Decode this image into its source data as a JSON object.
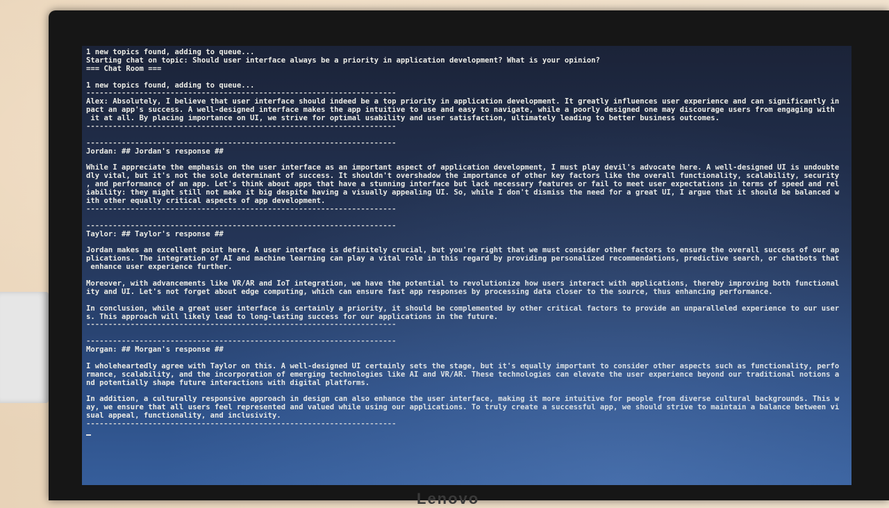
{
  "terminal": {
    "lines": [
      "1 new topics found, adding to queue...",
      "Starting chat on topic: Should user interface always be a priority in application development? What is your opinion?",
      "=== Chat Room ===",
      "",
      "1 new topics found, adding to queue...",
      "----------------------------------------------------------------------",
      "Alex: Absolutely, I believe that user interface should indeed be a top priority in application development. It greatly influences user experience and can significantly in",
      "pact an app's success. A well-designed interface makes the app intuitive to use and easy to navigate, while a poorly designed one may discourage users from engaging with",
      " it at all. By placing importance on UI, we strive for optimal usability and user satisfaction, ultimately leading to better business outcomes.",
      "----------------------------------------------------------------------",
      "",
      "----------------------------------------------------------------------",
      "Jordan: ## Jordan's response ##",
      "",
      "While I appreciate the emphasis on the user interface as an important aspect of application development, I must play devil's advocate here. A well-designed UI is undoubte",
      "dly vital, but it's not the sole determinant of success. It shouldn't overshadow the importance of other key factors like the overall functionality, scalability, security",
      ", and performance of an app. Let's think about apps that have a stunning interface but lack necessary features or fail to meet user expectations in terms of speed and rel",
      "iability: they might still not make it big despite having a visually appealing UI. So, while I don't dismiss the need for a great UI, I argue that it should be balanced w",
      "ith other equally critical aspects of app development.",
      "----------------------------------------------------------------------",
      "",
      "----------------------------------------------------------------------",
      "Taylor: ## Taylor's response ##",
      "",
      "Jordan makes an excellent point here. A user interface is definitely crucial, but you're right that we must consider other factors to ensure the overall success of our ap",
      "plications. The integration of AI and machine learning can play a vital role in this regard by providing personalized recommendations, predictive search, or chatbots that",
      " enhance user experience further.",
      "",
      "Moreover, with advancements like VR/AR and IoT integration, we have the potential to revolutionize how users interact with applications, thereby improving both functional",
      "ity and UI. Let's not forget about edge computing, which can ensure fast app responses by processing data closer to the source, thus enhancing performance.",
      "",
      "In conclusion, while a great user interface is certainly a priority, it should be complemented by other critical factors to provide an unparalleled experience to our user",
      "s. This approach will likely lead to long-lasting success for our applications in the future.",
      "----------------------------------------------------------------------",
      "",
      "----------------------------------------------------------------------",
      "Morgan: ## Morgan's response ##",
      "",
      "I wholeheartedly agree with Taylor on this. A well-designed UI certainly sets the stage, but it's equally important to consider other aspects such as functionality, perfo",
      "rmance, scalability, and the incorporation of emerging technologies like AI and VR/AR. These technologies can elevate the user experience beyond our traditional notions a",
      "nd potentially shape future interactions with digital platforms.",
      "",
      "In addition, a culturally responsive approach in design can also enhance the user interface, making it more intuitive for people from diverse cultural backgrounds. This w",
      "ay, we ensure that all users feel represented and valued while using our applications. To truly create a successful app, we should strive to maintain a balance between vi",
      "sual appeal, functionality, and inclusivity.",
      "----------------------------------------------------------------------"
    ]
  },
  "monitor": {
    "brand": "Lenovo"
  },
  "colors": {
    "screen_bg": "#243557",
    "text": "#ecece6",
    "bezel": "#161616"
  }
}
